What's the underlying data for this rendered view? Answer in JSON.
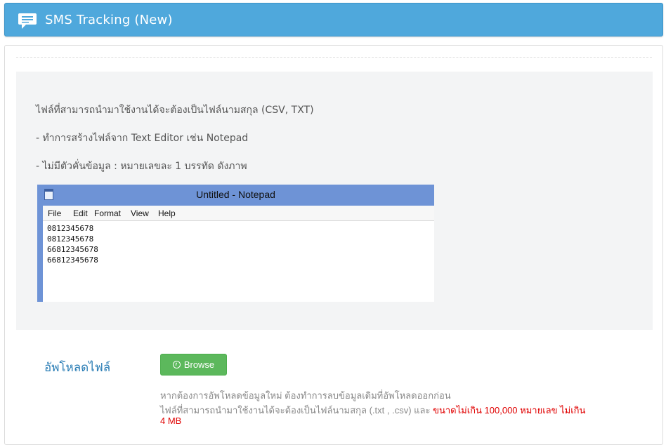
{
  "header": {
    "title": "SMS Tracking (New)",
    "icon": "chat-bubble-icon",
    "bg_color": "#4fa8dc"
  },
  "info": {
    "line1": "ไฟล์ที่สามารถนำมาใช้งานได้จะต้องเป็นไฟล์นามสกุล (CSV, TXT)",
    "line2": "- ทำการสร้างไฟล์จาก Text Editor เช่น Notepad",
    "line3": "- ไม่มีตัวคั่นข้อมูล : หมายเลขละ 1 บรรทัด ดังภาพ"
  },
  "notepad": {
    "title": "Untitled - Notepad",
    "menu": [
      "File",
      "Edit",
      "Format",
      "View",
      "Help"
    ],
    "lines": [
      "0812345678",
      "0812345678",
      "66812345678",
      "66812345678"
    ]
  },
  "upload": {
    "label": "อัพโหลดไฟล์",
    "browse_label": "Browse",
    "button_color": "#5cb85c",
    "note1": "หากต้องการอัพโหลดข้อมูลใหม่ ต้องทำการลบข้อมูลเดิมที่อัพโหลดออกก่อน",
    "note2_gray": "ไฟล์ที่สามารถนำมาใช้งานได้จะต้องเป็นไฟล์นามสกุล (.txt , .csv) และ ",
    "note2_red": "ขนาดไม่เกิน 100,000 หมายเลข ไม่เกิน 4 MB"
  }
}
